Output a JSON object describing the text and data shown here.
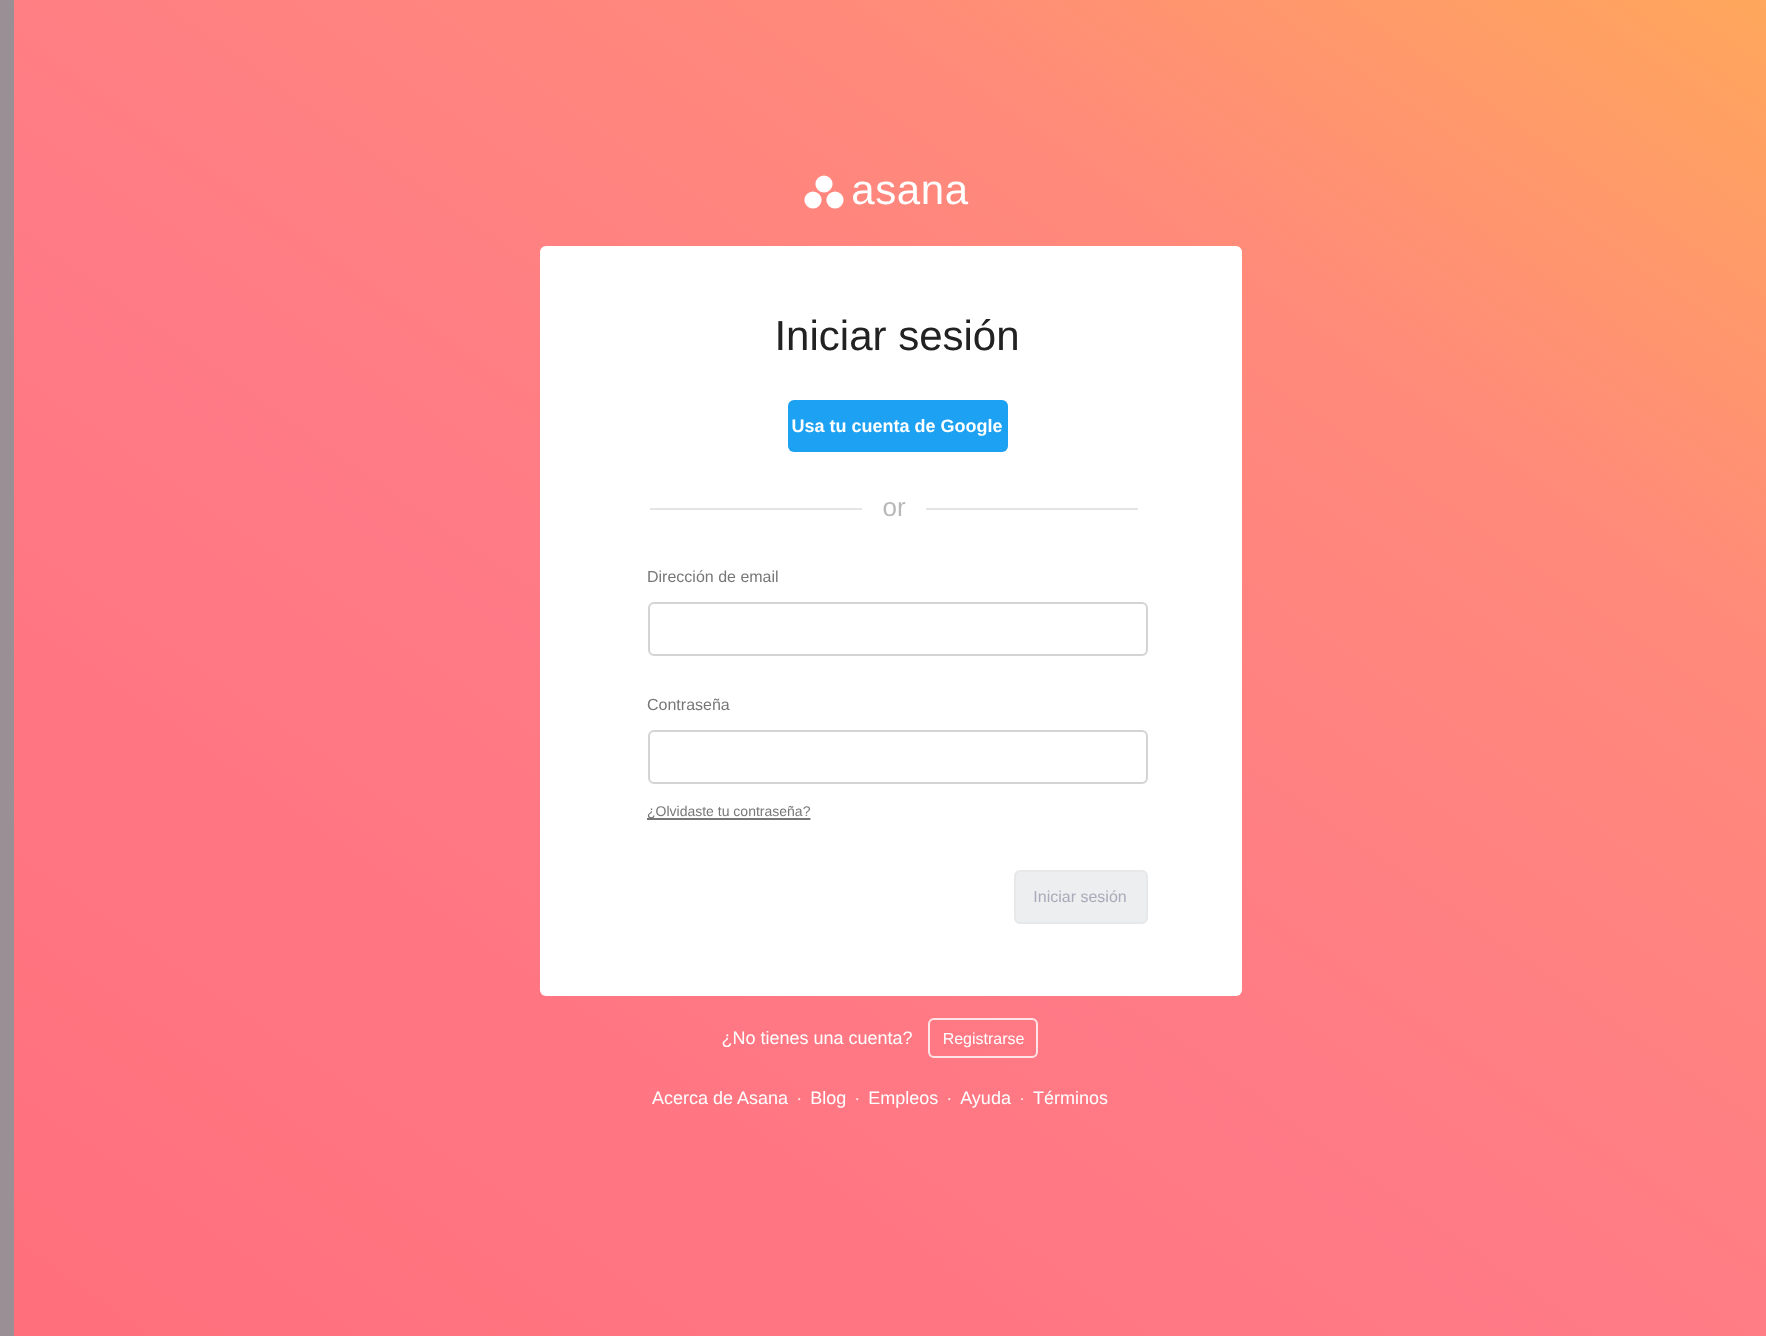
{
  "logo": {
    "text": "asana"
  },
  "card": {
    "title": "Iniciar sesión",
    "google_button": "Usa tu cuenta de Google",
    "divider": "or",
    "fields": [
      {
        "label": "Dirección de email"
      },
      {
        "label": "Contraseña"
      }
    ],
    "forgot_link": "¿Olvidaste tu contraseña?",
    "submit": {
      "label": "Iniciar sesión",
      "disabled": true
    }
  },
  "signup": {
    "text": "¿No tienes una cuenta?",
    "button": "Registrarse"
  },
  "footer": {
    "separator": "·",
    "links": [
      "Acerca de Asana",
      "Blog",
      "Empleos",
      "Ayuda",
      "Términos"
    ]
  }
}
